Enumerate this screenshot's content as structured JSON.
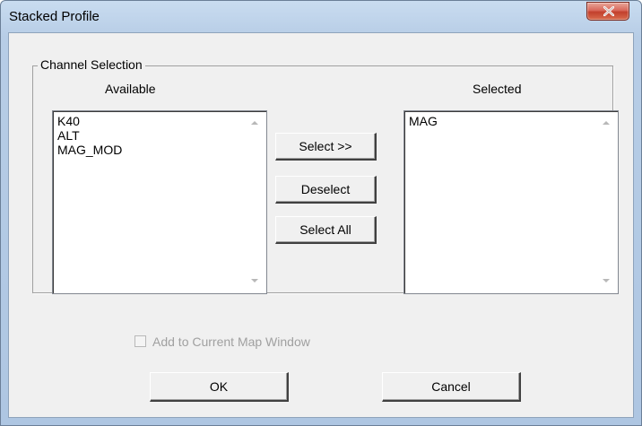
{
  "window": {
    "title": "Stacked Profile",
    "close_icon": "close-icon"
  },
  "channel_selection": {
    "group_label": "Channel Selection",
    "available_label": "Available",
    "selected_label": "Selected",
    "available_items": [
      "K40",
      "ALT",
      "MAG_MOD"
    ],
    "selected_items": [
      "MAG"
    ]
  },
  "buttons": {
    "select": "Select >>",
    "deselect": "Deselect",
    "select_all": "Select All",
    "ok": "OK",
    "cancel": "Cancel"
  },
  "options": {
    "add_to_map_label": "Add to Current Map Window",
    "add_to_map_checked": false,
    "add_to_map_enabled": false
  },
  "colors": {
    "close_button": "#c2402d",
    "disabled_text": "#a0a0a0",
    "dialog_face": "#f0f0f0"
  }
}
